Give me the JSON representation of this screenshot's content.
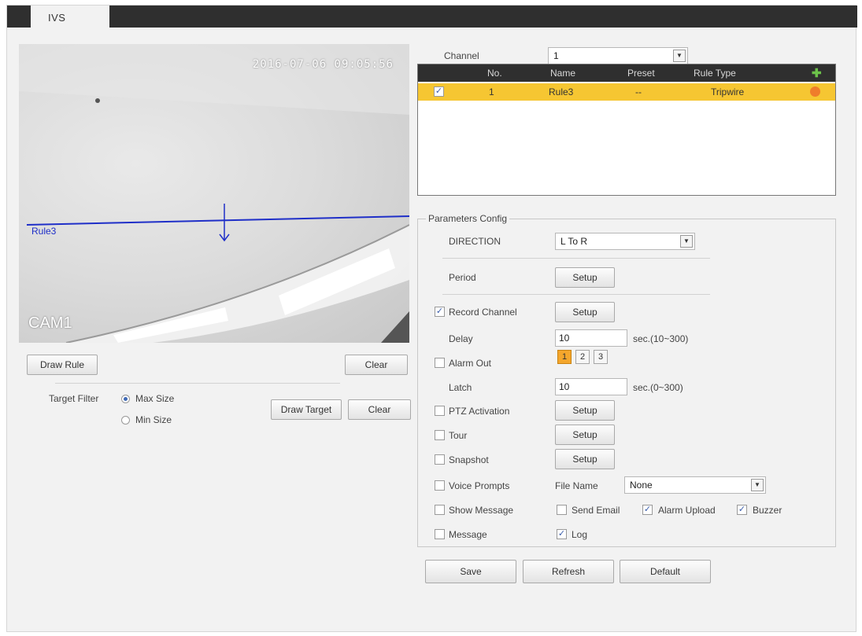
{
  "tabs": [
    {
      "label": "IVS"
    }
  ],
  "video": {
    "timestamp": "2016-07-06 09:05:56",
    "camera_label": "CAM1",
    "rule_label": "Rule3"
  },
  "left_controls": {
    "draw_rule_label": "Draw Rule",
    "clear_label": "Clear",
    "target_filter_label": "Target Filter",
    "max_size_label": "Max Size",
    "min_size_label": "Min Size",
    "draw_target_label": "Draw Target",
    "clear_target_label": "Clear"
  },
  "channel": {
    "label": "Channel",
    "value": "1"
  },
  "rule_table": {
    "headers": {
      "no": "No.",
      "name": "Name",
      "preset": "Preset",
      "rule_type": "Rule Type"
    },
    "rows": [
      {
        "no": "1",
        "name": "Rule3",
        "preset": "--",
        "rule_type": "Tripwire",
        "checked": true
      }
    ]
  },
  "params": {
    "legend": "Parameters Config",
    "direction_label": "DIRECTION",
    "direction_value": "L To R",
    "period_label": "Period",
    "setup_label": "Setup",
    "record_channel_label": "Record Channel",
    "delay_label": "Delay",
    "delay_value": "10",
    "delay_range": "sec.(10~300)",
    "alarm_out_label": "Alarm Out",
    "alarm_outputs": [
      "1",
      "2",
      "3"
    ],
    "latch_label": "Latch",
    "latch_value": "10",
    "latch_range": "sec.(0~300)",
    "ptz_label": "PTZ Activation",
    "tour_label": "Tour",
    "snapshot_label": "Snapshot",
    "voice_label": "Voice Prompts",
    "file_name_label": "File Name",
    "file_name_value": "None",
    "show_message_label": "Show Message",
    "send_email_label": "Send Email",
    "alarm_upload_label": "Alarm Upload",
    "buzzer_label": "Buzzer",
    "message_label": "Message",
    "log_label": "Log"
  },
  "footer": {
    "save_label": "Save",
    "refresh_label": "Refresh",
    "default_label": "Default"
  },
  "colors": {
    "accent": "#f6c632",
    "header": "#2f2f2f",
    "tripwire": "#1f2fc8",
    "alarm_active": "#f4a62c"
  },
  "icons": {
    "add": "add-icon",
    "delete": "delete-icon"
  }
}
